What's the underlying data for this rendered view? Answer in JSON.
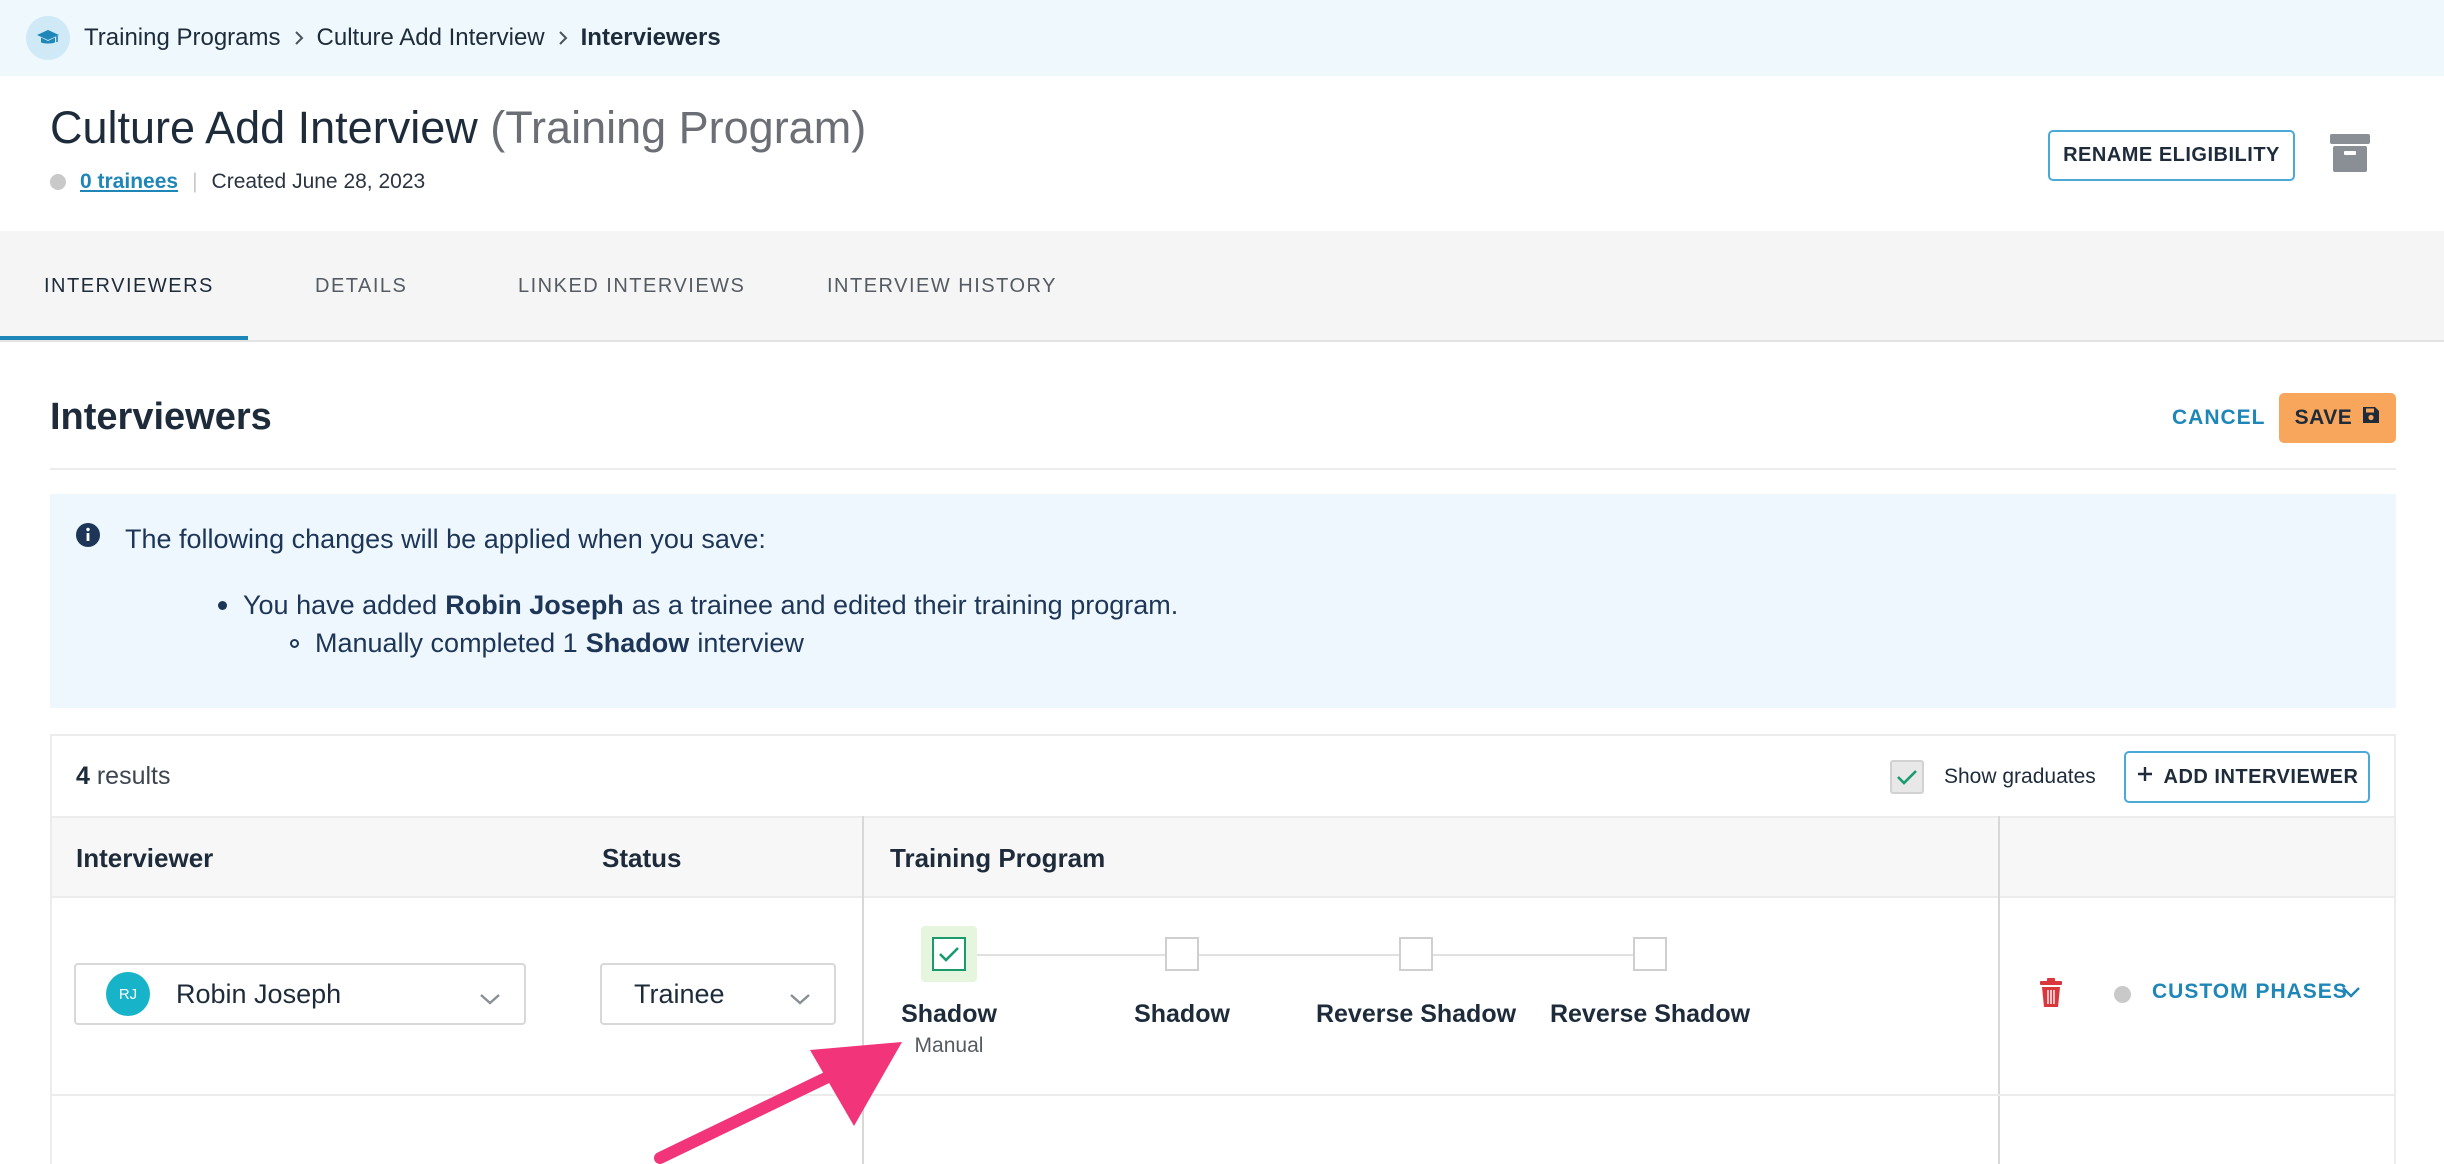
{
  "breadcrumb": {
    "items": [
      "Training Programs",
      "Culture Add Interview",
      "Interviewers"
    ]
  },
  "header": {
    "title": "Culture Add Interview",
    "subtitle": "(Training Program)",
    "trainees_link": "0 trainees",
    "created": "Created June 28, 2023",
    "rename_button": "RENAME ELIGIBILITY"
  },
  "tabs": [
    {
      "label": "INTERVIEWERS",
      "active": true
    },
    {
      "label": "DETAILS",
      "active": false
    },
    {
      "label": "LINKED INTERVIEWS",
      "active": false
    },
    {
      "label": "INTERVIEW HISTORY",
      "active": false
    }
  ],
  "section": {
    "title": "Interviewers",
    "cancel": "CANCEL",
    "save": "SAVE"
  },
  "notice": {
    "intro": "The following changes will be applied when you save:",
    "change_pre": "You have added",
    "change_name": "Robin Joseph",
    "change_post": "as a trainee and edited their training program.",
    "detail_pre": "Manually completed 1",
    "detail_phase": "Shadow",
    "detail_post": "interview"
  },
  "table": {
    "results_count": "4",
    "results_label": "results",
    "show_graduates": "Show graduates",
    "show_graduates_checked": true,
    "add_button": "ADD INTERVIEWER",
    "columns": [
      "Interviewer",
      "Status",
      "Training Program"
    ],
    "rows": [
      {
        "initials": "RJ",
        "name": "Robin Joseph",
        "status": "Trainee",
        "phases": [
          {
            "label": "Shadow",
            "sub": "Manual",
            "done": true
          },
          {
            "label": "Shadow",
            "sub": "",
            "done": false
          },
          {
            "label": "Reverse Shadow",
            "sub": "",
            "done": false
          },
          {
            "label": "Reverse Shadow",
            "sub": "",
            "done": false
          }
        ],
        "phase_mode": "CUSTOM PHASES"
      }
    ]
  },
  "colors": {
    "accent": "#1f86b8",
    "save": "#f7a65c",
    "avatar": "#17b4c9",
    "trash": "#d9363e",
    "arrow": "#f2357a",
    "check": "#1a9b6e"
  }
}
